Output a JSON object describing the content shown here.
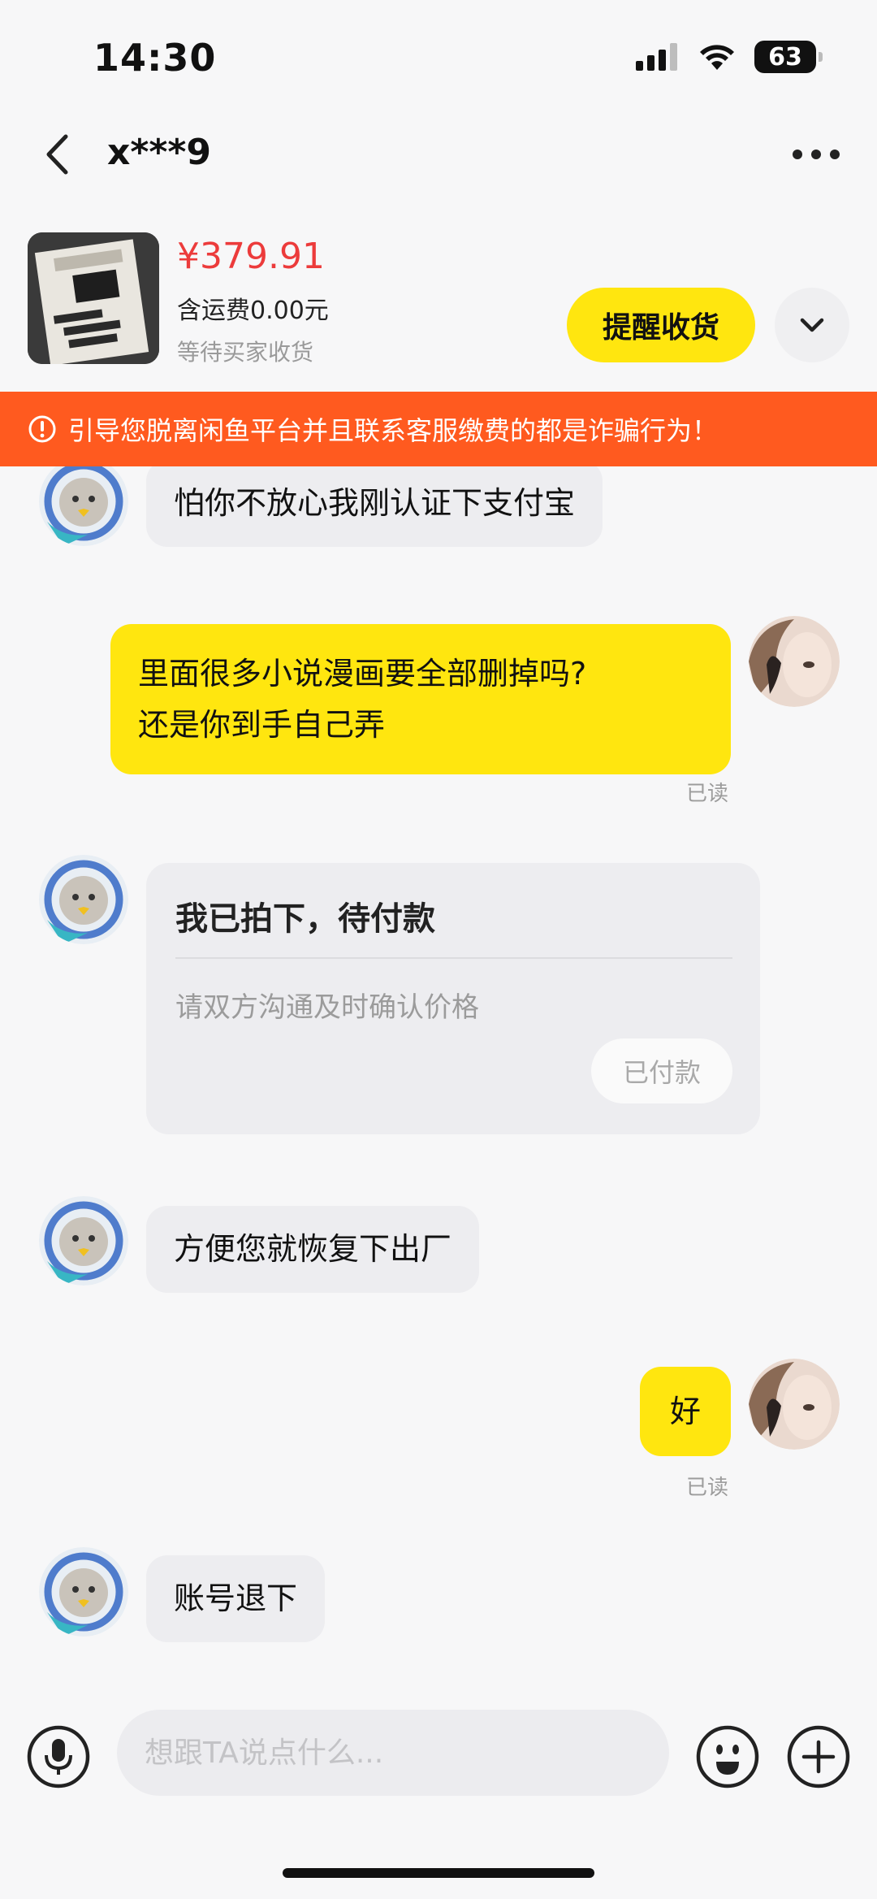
{
  "status": {
    "time": "14:30",
    "battery": "63"
  },
  "header": {
    "title": "x***9"
  },
  "product": {
    "price": "¥379.91",
    "shipping": "含运费0.00元",
    "status": "等待买家收货",
    "remind_label": "提醒收货"
  },
  "warning": {
    "text": "引导您脱离闲鱼平台并且联系客服缴费的都是诈骗行为！"
  },
  "messages": [
    {
      "side": "left",
      "text": "怕你不放心我刚认证下支付宝"
    },
    {
      "side": "right",
      "lines": [
        "里面很多小说漫画要全部删掉吗?",
        "还是你到手自己弄"
      ],
      "read": "已读"
    },
    {
      "side": "left",
      "type": "order-card",
      "title": "我已拍下，待付款",
      "subtitle": "请双方沟通及时确认价格",
      "button": "已付款"
    },
    {
      "side": "left",
      "text": "方便您就恢复下出厂"
    },
    {
      "side": "right",
      "text": "好",
      "read": "已读"
    },
    {
      "side": "left",
      "text": "账号退下"
    }
  ],
  "input": {
    "placeholder": "想跟TA说点什么..."
  },
  "colors": {
    "accent": "#ffe60f",
    "warning": "#ff5a1f",
    "price": "#ec3b3b"
  },
  "icons": [
    "back-icon",
    "more-icon",
    "chevron-down-icon",
    "warning-icon",
    "microphone-icon",
    "emoji-icon",
    "plus-icon"
  ]
}
